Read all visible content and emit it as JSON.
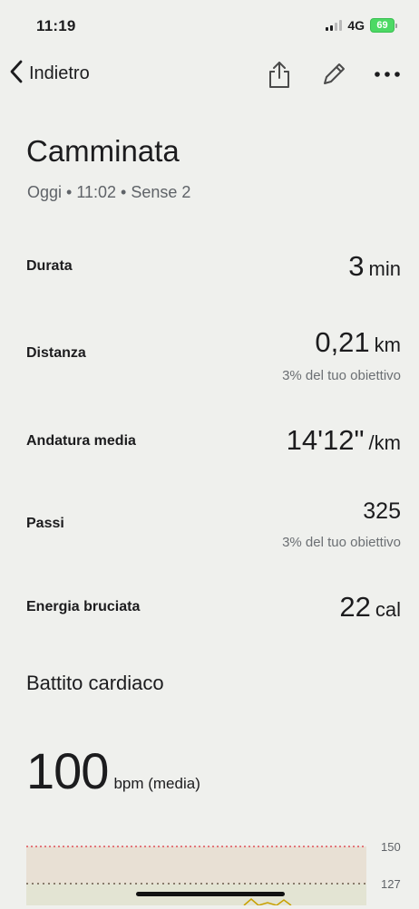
{
  "status_bar": {
    "time": "11:19",
    "network": "4G",
    "battery": "69"
  },
  "nav": {
    "back_label": "Indietro",
    "icons": [
      "share-icon",
      "pencil-icon",
      "more-icon"
    ]
  },
  "activity": {
    "title": "Camminata",
    "subtitle": "Oggi • 11:02 • Sense 2"
  },
  "metrics": [
    {
      "label": "Durata",
      "value": "3",
      "unit": "min",
      "sub": ""
    },
    {
      "label": "Distanza",
      "value": "0,21",
      "unit": "km",
      "sub": "3% del tuo obiettivo"
    },
    {
      "label": "Andatura media",
      "value": "14'12\"",
      "unit": "/km",
      "sub": ""
    },
    {
      "label": "Passi",
      "value": "325",
      "unit": "",
      "sub": "3% del tuo obiettivo"
    },
    {
      "label": "Energia bruciata",
      "value": "22",
      "unit": "cal",
      "sub": ""
    }
  ],
  "heart_rate": {
    "title": "Battito cardiaco",
    "value": "100",
    "unit": "bpm (media)",
    "chart": {
      "upper_tick": "150",
      "lower_tick": "127"
    }
  },
  "colors": {
    "background": "#eff0ed",
    "battery": "#4cd964",
    "chart_top_band": "#e8e0d4",
    "chart_lower_band": "#e4e3d4",
    "chart_red_line": "#e0505a",
    "chart_line": "#c8a000"
  }
}
